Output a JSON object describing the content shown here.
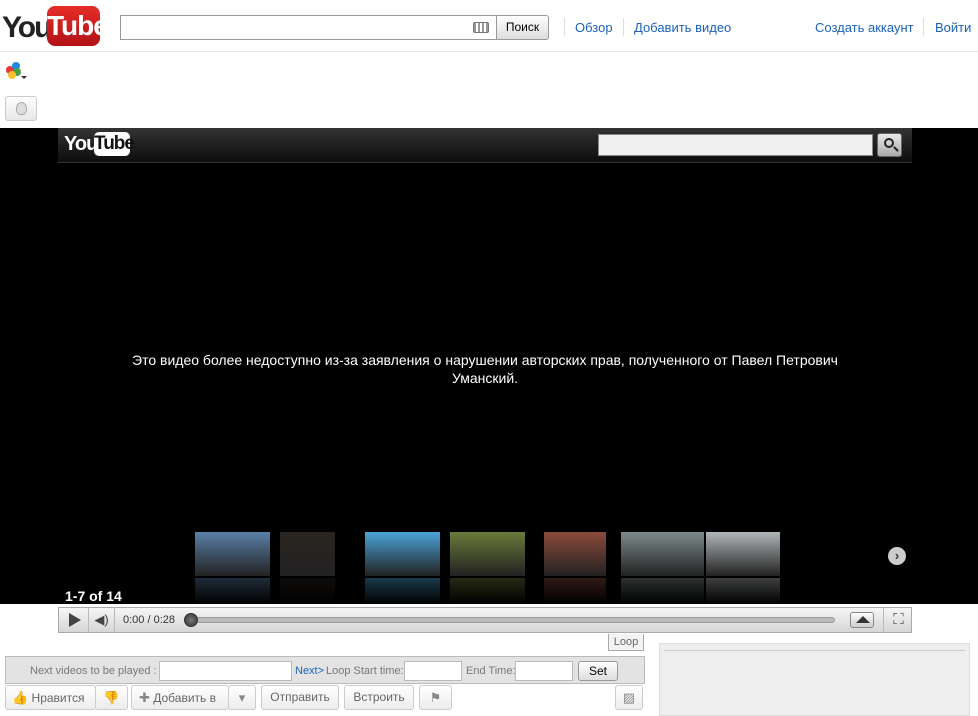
{
  "header": {
    "logo_you": "You",
    "logo_tube": "Tube",
    "search_button": "Поиск",
    "nav_browse": "Обзор",
    "nav_upload": "Добавить видео",
    "create_account": "Создать аккаунт",
    "sign_in": "Войти"
  },
  "player": {
    "logo_you": "You",
    "logo_tube": "Tube",
    "message": "Это видео более недоступно из-за заявления о нарушении авторских прав, полученного от Павел Петрович Уманский.",
    "page_count": "1-7 of 14",
    "time": "0:00 / 0:28",
    "progress": 0.0
  },
  "thumbnails": [
    {
      "name": "thumb-1",
      "color": "#5a7fa6"
    },
    {
      "name": "thumb-2",
      "color": "#2a2520"
    },
    {
      "name": "thumb-3",
      "color": "#4aa3d6"
    },
    {
      "name": "thumb-4",
      "color": "#6a7a3a"
    },
    {
      "name": "thumb-5",
      "color": "#8a4a3a"
    },
    {
      "name": "thumb-6",
      "color": "#7d8a8a"
    },
    {
      "name": "thumb-7",
      "color": "#b0b5b8"
    }
  ],
  "loop": {
    "tab": "Loop",
    "next_videos": "Next videos to be played :",
    "next_link": "Next>",
    "start_time": "Loop Start time:",
    "end_time": "End Time:",
    "set": "Set"
  },
  "actions": {
    "like": "Нравится",
    "add_to": "Добавить в",
    "share": "Отправить",
    "embed": "Встроить"
  },
  "colors": {
    "link": "#1c62b9",
    "logo_red": "#e52d27"
  }
}
